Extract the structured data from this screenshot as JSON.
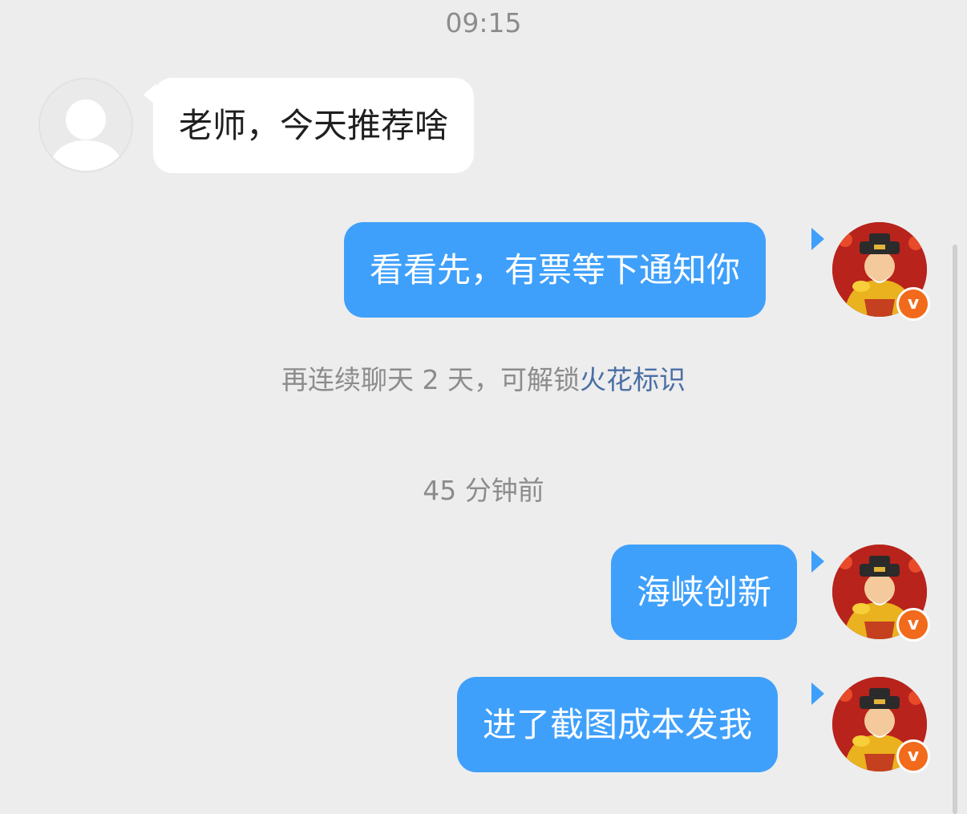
{
  "timestamps": [
    "09:15",
    "45 分钟前"
  ],
  "messages": [
    {
      "side": "left",
      "text": "老师，今天推荐啥"
    },
    {
      "side": "right",
      "text": "看看先，有票等下通知你"
    },
    {
      "side": "right",
      "text": "海峡创新"
    },
    {
      "side": "right",
      "text": "进了截图成本发我"
    }
  ],
  "notice": {
    "prefix": "再连续聊天 2 天，可解锁",
    "link": "火花标识"
  },
  "badge": {
    "label": "v",
    "color": "#f26a1b"
  },
  "colors": {
    "background": "#ededed",
    "bubble_sent": "#3fa0fb",
    "bubble_received": "#ffffff"
  }
}
